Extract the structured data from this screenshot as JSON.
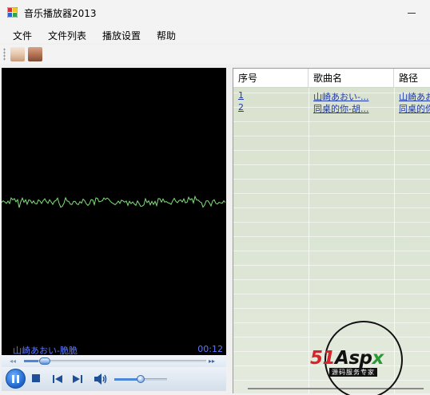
{
  "window": {
    "title": "音乐播放器2013"
  },
  "menu": {
    "items": [
      "文件",
      "文件列表",
      "播放设置",
      "帮助"
    ]
  },
  "toolbar": {
    "buttons": [
      {
        "icon": "album-thumbnail-1"
      },
      {
        "icon": "album-thumbnail-2"
      }
    ]
  },
  "player": {
    "now_playing": "山崎あおい-脆脆",
    "elapsed": "00:12",
    "seek_position": 0.08,
    "volume": 0.5,
    "waveform_color": "#7ee07a",
    "seek_left_glyph": "◂◂",
    "seek_right_glyph": "▸▸"
  },
  "playlist": {
    "columns": [
      "序号",
      "歌曲名",
      "路径"
    ],
    "rows": [
      {
        "index": "1",
        "name": "山崎あおい-...",
        "path": "山崎あお"
      },
      {
        "index": "2",
        "name": "同桌的你-胡...",
        "path": "同桌的你"
      }
    ]
  },
  "watermark": {
    "brand_red": "51",
    "brand_black": "Asp",
    "brand_green": "x",
    "tagline": "源码服务专家"
  },
  "colors": {
    "accent": "#1c63c8",
    "link": "#1f3aa8",
    "now_playing_text": "#5d79ff"
  }
}
